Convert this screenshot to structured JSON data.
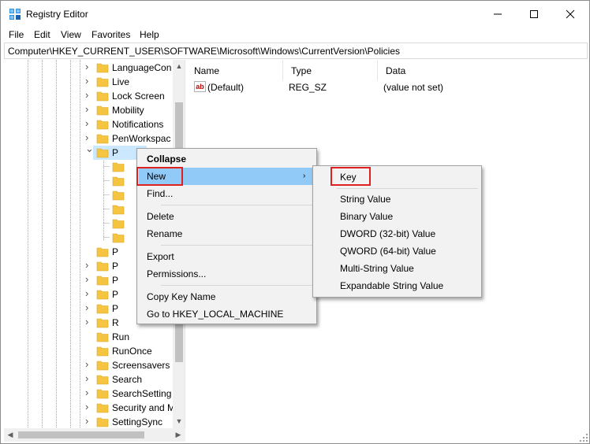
{
  "window": {
    "title": "Registry Editor",
    "icon": "registry-editor-icon"
  },
  "menubar": {
    "items": [
      "File",
      "Edit",
      "View",
      "Favorites",
      "Help"
    ]
  },
  "address": {
    "path": "Computer\\HKEY_CURRENT_USER\\SOFTWARE\\Microsoft\\Windows\\CurrentVersion\\Policies"
  },
  "tree": {
    "items": [
      {
        "label": "LanguageCon",
        "expandable": true
      },
      {
        "label": "Live",
        "expandable": true
      },
      {
        "label": "Lock Screen",
        "expandable": true
      },
      {
        "label": "Mobility",
        "expandable": true
      },
      {
        "label": "Notifications",
        "expandable": true
      },
      {
        "label": "PenWorkspac",
        "expandable": true
      },
      {
        "label": "P",
        "expandable": true,
        "expanded": true,
        "selected": true
      },
      {
        "label": "",
        "child": true
      },
      {
        "label": "",
        "child": true
      },
      {
        "label": "",
        "child": true
      },
      {
        "label": "",
        "child": true
      },
      {
        "label": "",
        "child": true
      },
      {
        "label": "",
        "child": true
      },
      {
        "label": "P",
        "expandable": false
      },
      {
        "label": "P",
        "expandable": true
      },
      {
        "label": "P",
        "expandable": true
      },
      {
        "label": "P",
        "expandable": true
      },
      {
        "label": "P",
        "expandable": true
      },
      {
        "label": "R",
        "expandable": true
      },
      {
        "label": "Run",
        "expandable": false
      },
      {
        "label": "RunOnce",
        "expandable": false
      },
      {
        "label": "Screensavers",
        "expandable": true
      },
      {
        "label": "Search",
        "expandable": true
      },
      {
        "label": "SearchSetting",
        "expandable": true
      },
      {
        "label": "Security and M",
        "expandable": true
      },
      {
        "label": "SettingSync",
        "expandable": true
      }
    ]
  },
  "list": {
    "columns": [
      "Name",
      "Type",
      "Data"
    ],
    "rows": [
      {
        "name": "(Default)",
        "type": "REG_SZ",
        "data": "(value not set)"
      }
    ]
  },
  "context_menu": {
    "items": [
      "Collapse",
      "New",
      "Find...",
      "Delete",
      "Rename",
      "Export",
      "Permissions...",
      "Copy Key Name",
      "Go to HKEY_LOCAL_MACHINE"
    ]
  },
  "submenu": {
    "items": [
      "Key",
      "String Value",
      "Binary Value",
      "DWORD (32-bit) Value",
      "QWORD (64-bit) Value",
      "Multi-String Value",
      "Expandable String Value"
    ]
  },
  "colors": {
    "highlight": "#91c9f7",
    "annotation": "#e0201e",
    "folder": "#f5c542"
  }
}
